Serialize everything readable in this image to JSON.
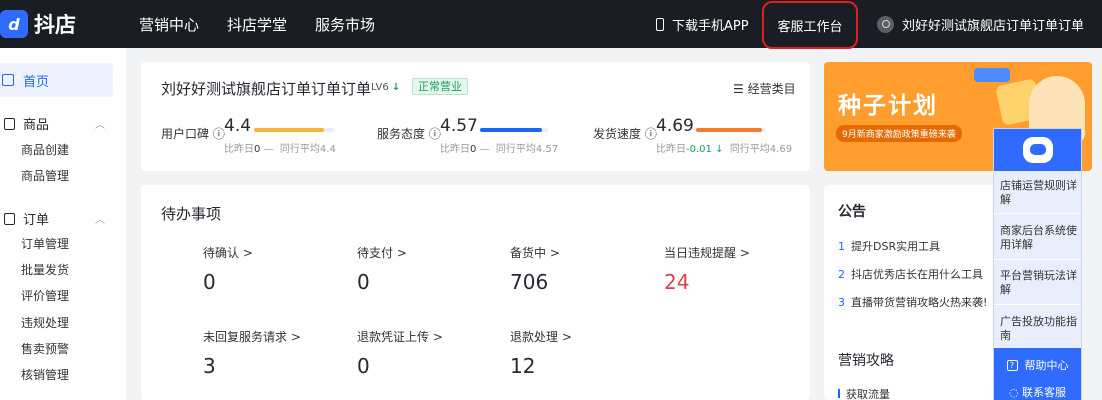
{
  "topbar": {
    "logo_mark": "d",
    "logo_text": "抖店",
    "nav": [
      "营销中心",
      "抖店学堂",
      "服务市场"
    ],
    "download_app": "下载手机APP",
    "kefu": "客服工作台",
    "user_name": "刘好好测试旗舰店订单订单订单"
  },
  "sidebar": {
    "home": "首页",
    "groups": [
      {
        "label": "商品",
        "items": [
          "商品创建",
          "商品管理"
        ]
      },
      {
        "label": "订单",
        "items": [
          "订单管理",
          "批量发货",
          "评价管理",
          "违规处理",
          "售卖预警",
          "核销管理"
        ]
      }
    ]
  },
  "shop": {
    "name": "刘好好测试旗舰店订单订单订单",
    "level": "LV6",
    "status": "正常营业",
    "category": "经营类目",
    "metrics": [
      {
        "label": "用户口碑",
        "value": "4.4",
        "compare_label": "比昨日",
        "compare": "0",
        "change_mark": "—",
        "peer": "同行平均4.4",
        "color": "#f5b53b",
        "level": 0.88
      },
      {
        "label": "服务态度",
        "value": "4.57",
        "compare_label": "比昨日",
        "compare": "0",
        "change_mark": "—",
        "peer": "同行平均4.57",
        "color": "#1966ff",
        "level": 0.914
      },
      {
        "label": "发货速度",
        "value": "4.69",
        "compare_label": "比昨日",
        "compare": "-0.01",
        "change_mark": "↓",
        "peer": "同行平均4.69",
        "color": "#f57b2a",
        "level": 0.938
      }
    ]
  },
  "banner": {
    "title": "种子计划",
    "subtitle": "9月新商家激励政策重磅来袭"
  },
  "todo": {
    "title": "待办事项",
    "items": [
      {
        "label": "待确认 >",
        "value": "0"
      },
      {
        "label": "待支付 >",
        "value": "0"
      },
      {
        "label": "备货中 >",
        "value": "706"
      },
      {
        "label": "当日违规提醒 >",
        "value": "24"
      },
      {
        "label": "未回复服务请求 >",
        "value": "3"
      },
      {
        "label": "退款凭证上传 >",
        "value": "0"
      },
      {
        "label": "退款处理 >",
        "value": "12"
      }
    ]
  },
  "notice": {
    "title": "公告",
    "items": [
      {
        "n": "1",
        "text": "提升DSR实用工具"
      },
      {
        "n": "2",
        "text": "抖店优秀店长在用什么工具"
      },
      {
        "n": "3",
        "text": "直播带货营销攻略火热来袭!"
      }
    ],
    "strategy_title": "营销攻略",
    "strategy_item": "获取流量"
  },
  "help": {
    "links": [
      "店铺运营规则详解",
      "商家后台系统使用详解",
      "平台营销玩法详解",
      "广告投放功能指南"
    ],
    "center": "帮助中心",
    "more": "联系客服"
  }
}
